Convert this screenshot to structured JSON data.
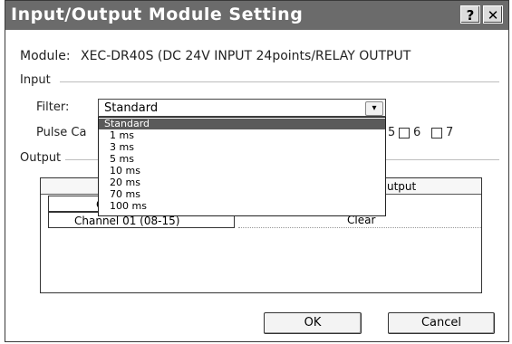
{
  "window": {
    "title": "Input/Output Module Setting",
    "help_label": "?",
    "close_label": "✕"
  },
  "module": {
    "label": "Module:",
    "value": "XEC-DR40S (DC 24V INPUT 24points/RELAY OUTPUT"
  },
  "input": {
    "section_label": "Input",
    "filter_label": "Filter:",
    "filter_value": "Standard",
    "filter_options": [
      "Standard",
      "1 ms",
      "3 ms",
      "5 ms",
      "10 ms",
      "20 ms",
      "70 ms",
      "100 ms"
    ],
    "pulse_label": "Pulse Ca",
    "pulse_visible_digit": "5",
    "checkbox_labels": [
      "6",
      "7"
    ]
  },
  "output": {
    "section_label": "Output",
    "column_header": "utput",
    "rows": [
      {
        "channel": "Cha",
        "value": ""
      },
      {
        "channel": "Channel 01 (08-15)",
        "value": "Clear"
      }
    ]
  },
  "buttons": {
    "ok": "OK",
    "cancel": "Cancel"
  }
}
